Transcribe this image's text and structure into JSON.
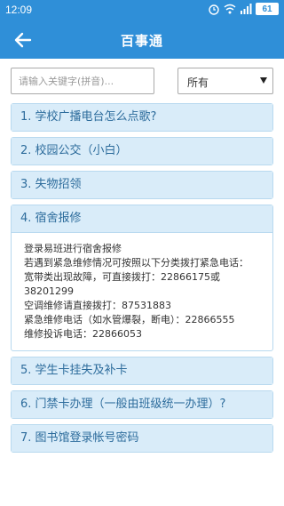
{
  "status_bar": {
    "time": "12:09",
    "battery": "61"
  },
  "app_bar": {
    "title": "百事通"
  },
  "search": {
    "placeholder": "请输入关键字(拼音)..."
  },
  "filter": {
    "selected": "所有"
  },
  "items": [
    {
      "label": "1. 学校广播电台怎么点歌?"
    },
    {
      "label": "2. 校园公交（小白）"
    },
    {
      "label": "3. 失物招领"
    },
    {
      "label": "4. 宿舍报修"
    },
    {
      "label": "5. 学生卡挂失及补卡"
    },
    {
      "label": "6. 门禁卡办理（一般由班级统一办理）?"
    },
    {
      "label": "7. 图书馆登录帐号密码"
    }
  ],
  "expanded_detail": {
    "lines": [
      "登录易班进行宿舍报修",
      "若遇到紧急维修情况可按照以下分类拨打紧急电话：",
      "宽带类出现故障，可直接拨打：22866175或38201299",
      "空调维修请直接拨打：87531883",
      "紧急维修电话（如水管爆裂，断电）：22866555",
      "维修投诉电话：22866053"
    ]
  },
  "colors": {
    "primary": "#2f8fd8",
    "item_header_bg": "#d9ecf9",
    "item_text": "#2d6c9c"
  }
}
